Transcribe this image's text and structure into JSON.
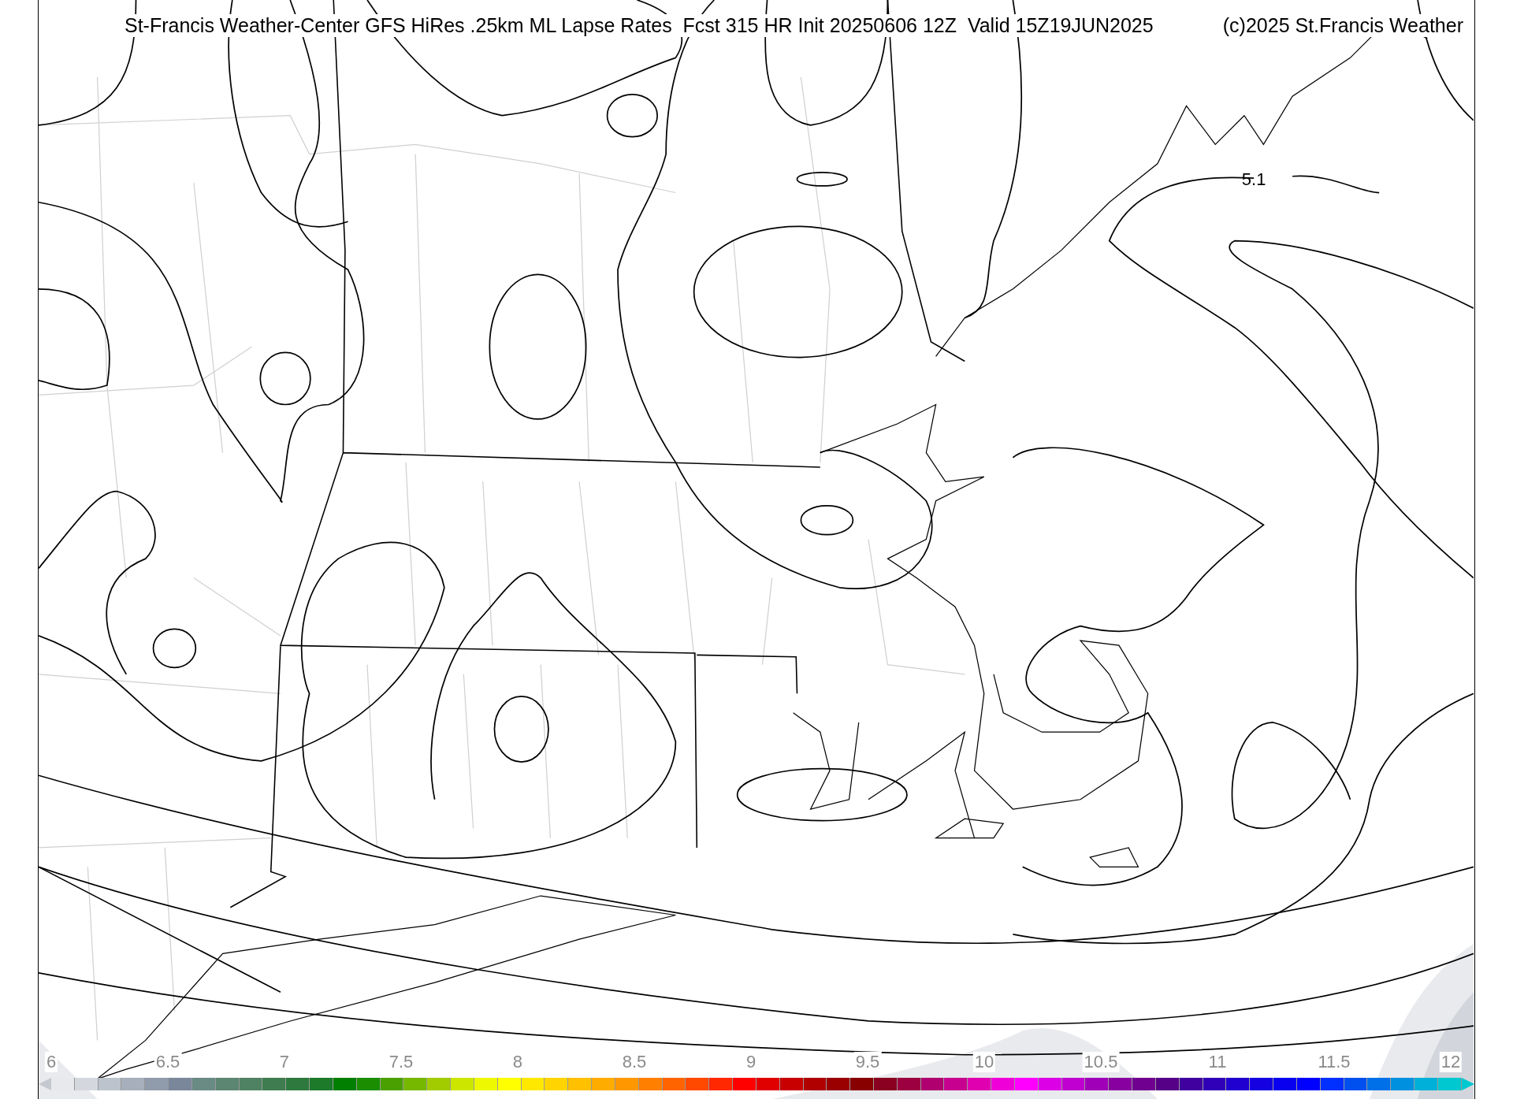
{
  "title": "St-Francis Weather-Center GFS HiRes .25km ML Lapse Rates  Fcst 315 HR Init 20250606 12Z  Valid 15Z19JUN2025",
  "copyright": "(c)2025 St.Francis Weather",
  "map": {
    "contour_labels": [
      "5.1"
    ]
  },
  "colorbar": {
    "ticks": [
      "6",
      "6.5",
      "7",
      "7.5",
      "8",
      "8.5",
      "9",
      "9.5",
      "10",
      "10.5",
      "11",
      "11.5",
      "12"
    ],
    "segments": [
      {
        "color": "#e8e9ec"
      },
      {
        "color": "#d4d8de"
      },
      {
        "color": "#bcc3cc"
      },
      {
        "color": "#a6afbb"
      },
      {
        "color": "#909bab"
      },
      {
        "color": "#7a879b"
      },
      {
        "color": "#6a8a84"
      },
      {
        "color": "#5c8672"
      },
      {
        "color": "#4f8262"
      },
      {
        "color": "#3f7d50"
      },
      {
        "color": "#2e7a3e"
      },
      {
        "color": "#1c7a2a"
      },
      {
        "color": "#007f00"
      },
      {
        "color": "#1a8e00"
      },
      {
        "color": "#4aa000"
      },
      {
        "color": "#76b800"
      },
      {
        "color": "#a2cc00"
      },
      {
        "color": "#cce600"
      },
      {
        "color": "#eef800"
      },
      {
        "color": "#ffff00"
      },
      {
        "color": "#ffe800"
      },
      {
        "color": "#ffd400"
      },
      {
        "color": "#ffc000"
      },
      {
        "color": "#ffac00"
      },
      {
        "color": "#ff9800"
      },
      {
        "color": "#ff7f00"
      },
      {
        "color": "#ff6400"
      },
      {
        "color": "#ff4800"
      },
      {
        "color": "#ff2800"
      },
      {
        "color": "#ff0000"
      },
      {
        "color": "#e00000"
      },
      {
        "color": "#c80000"
      },
      {
        "color": "#b00000"
      },
      {
        "color": "#9a0000"
      },
      {
        "color": "#880000"
      },
      {
        "color": "#8a0020"
      },
      {
        "color": "#9c0040"
      },
      {
        "color": "#b00070"
      },
      {
        "color": "#c80090"
      },
      {
        "color": "#e000b0"
      },
      {
        "color": "#f000d8"
      },
      {
        "color": "#ff00ff"
      },
      {
        "color": "#dc00e6"
      },
      {
        "color": "#c000d0"
      },
      {
        "color": "#a000b8"
      },
      {
        "color": "#8800a0"
      },
      {
        "color": "#700090"
      },
      {
        "color": "#560088"
      },
      {
        "color": "#4000a0"
      },
      {
        "color": "#3000b8"
      },
      {
        "color": "#2000d0"
      },
      {
        "color": "#1400e0"
      },
      {
        "color": "#0a00f0"
      },
      {
        "color": "#0000ff"
      },
      {
        "color": "#0030ff"
      },
      {
        "color": "#0050f0"
      },
      {
        "color": "#0070e8"
      },
      {
        "color": "#0090e0"
      },
      {
        "color": "#00b0d8"
      },
      {
        "color": "#00c8d0"
      }
    ]
  }
}
